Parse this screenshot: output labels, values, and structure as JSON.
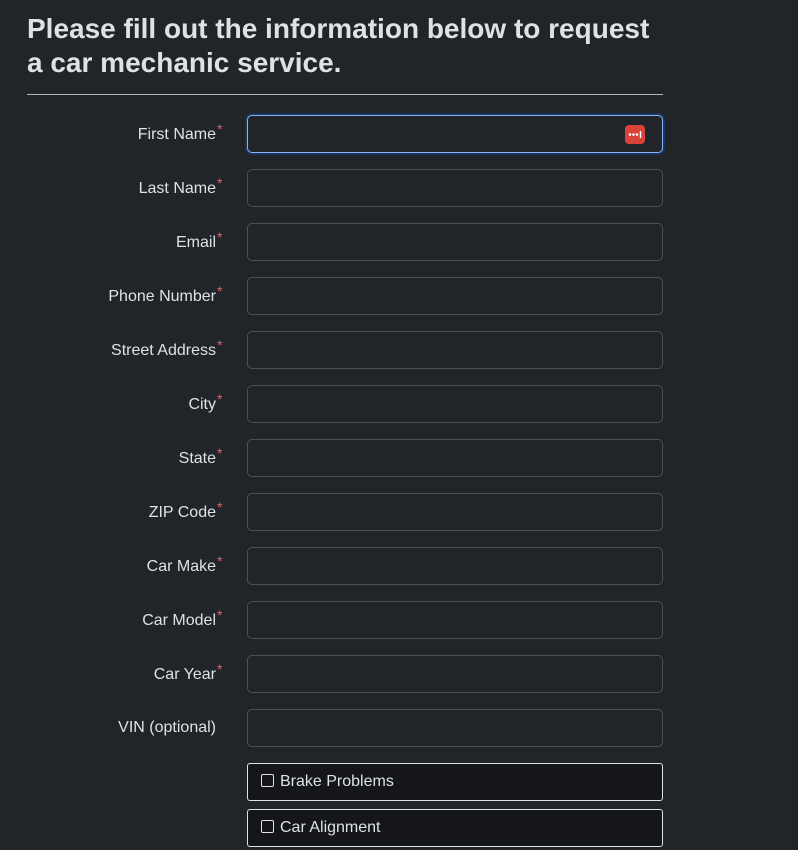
{
  "heading": "Please fill out the information below to request a car mechanic service.",
  "required_marker": "*",
  "fields": [
    {
      "label": "First Name",
      "required": true,
      "value": ""
    },
    {
      "label": "Last Name",
      "required": true,
      "value": ""
    },
    {
      "label": "Email",
      "required": true,
      "value": ""
    },
    {
      "label": "Phone Number",
      "required": true,
      "value": ""
    },
    {
      "label": "Street Address",
      "required": true,
      "value": ""
    },
    {
      "label": "City",
      "required": true,
      "value": ""
    },
    {
      "label": "State",
      "required": true,
      "value": ""
    },
    {
      "label": "ZIP Code",
      "required": true,
      "value": ""
    },
    {
      "label": "Car Make",
      "required": true,
      "value": ""
    },
    {
      "label": "Car Model",
      "required": true,
      "value": ""
    },
    {
      "label": "Car Year",
      "required": true,
      "value": ""
    },
    {
      "label": "VIN (optional)",
      "required": false,
      "value": ""
    }
  ],
  "services": [
    {
      "label": "Brake Problems",
      "checked": false
    },
    {
      "label": "Car Alignment",
      "checked": false
    }
  ],
  "icons": {
    "password_manager": "password-manager-icon"
  },
  "colors": {
    "background": "#212529",
    "required_asterisk": "#e35d6a",
    "focus_border": "#86b7fe",
    "password_manager": "#d9433a"
  }
}
